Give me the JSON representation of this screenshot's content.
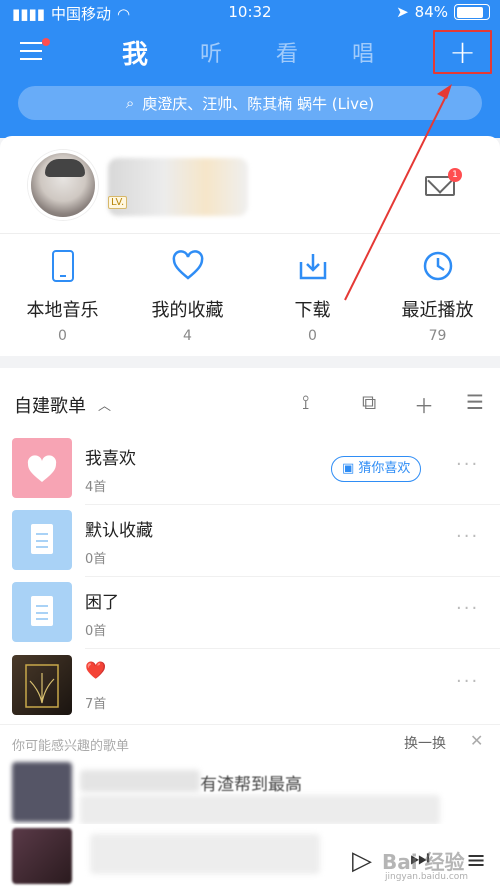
{
  "status_bar": {
    "carrier": "中国移动",
    "time": "10:32",
    "battery": "84%",
    "battery_level": 0.84
  },
  "tabs": [
    {
      "label": "我",
      "active": true
    },
    {
      "label": "听",
      "active": false
    },
    {
      "label": "看",
      "active": false
    },
    {
      "label": "唱",
      "active": false
    }
  ],
  "plus_icon": "+",
  "search": {
    "text": "庾澄庆、汪帅、陈其楠 蜗牛 (Live)"
  },
  "profile": {
    "level": "LV.",
    "mail_badge": "1"
  },
  "quick_actions": [
    {
      "label": "本地音乐",
      "count": "0",
      "icon": "phone-icon"
    },
    {
      "label": "我的收藏",
      "count": "4",
      "icon": "heart-icon"
    },
    {
      "label": "下载",
      "count": "0",
      "icon": "download-icon"
    },
    {
      "label": "最近播放",
      "count": "79",
      "icon": "clock-icon"
    }
  ],
  "playlists_section": {
    "title": "自建歌单"
  },
  "playlists": [
    {
      "title": "我喜欢",
      "count": "4首",
      "badge": "猜你喜欢"
    },
    {
      "title": "默认收藏",
      "count": "0首"
    },
    {
      "title": "困了",
      "count": "0首"
    },
    {
      "title": "❤️",
      "count": "7首"
    }
  ],
  "recommend": {
    "title": "你可能感兴趣的歌单",
    "refresh": "换一换",
    "close": "✕",
    "partial_text": "有渣帮到最高"
  },
  "player": {
    "play_icon": "▷",
    "next_icon": "⏭",
    "list_icon": "≡"
  },
  "watermark": {
    "text": "Bai 经验",
    "url": "jingyan.baidu.com"
  },
  "colors": {
    "accent": "#2f8df5",
    "highlight": "#e53935",
    "badge": "#ff4d4f"
  }
}
